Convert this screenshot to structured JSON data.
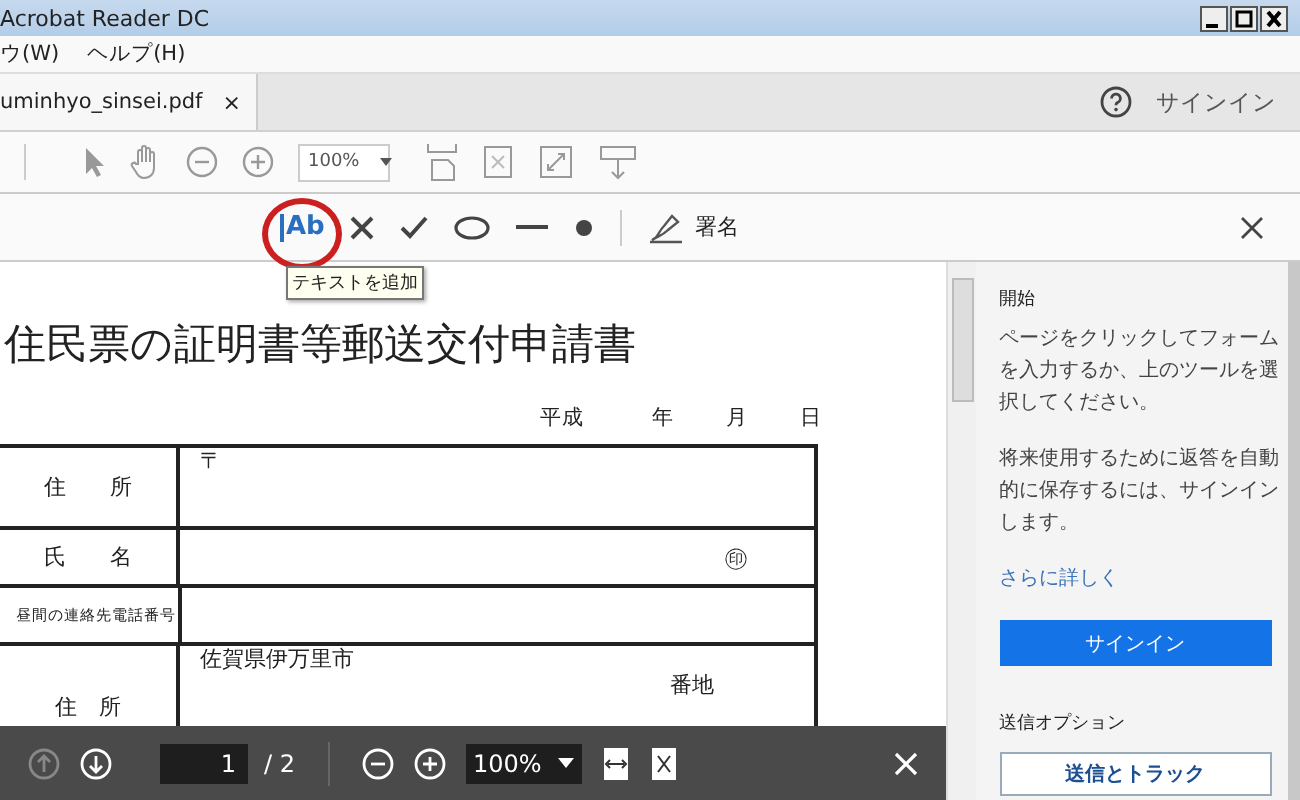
{
  "window": {
    "title": "Acrobat Reader DC"
  },
  "menu": [
    {
      "label": "ウ(W)"
    },
    {
      "label": "ヘルプ(H)"
    }
  ],
  "tab": {
    "label": "uminhyo_sinsei.pdf",
    "close": "×"
  },
  "account": {
    "signin": "サインイン"
  },
  "toolbar": {
    "zoom": "100%"
  },
  "fill_sign": {
    "tools": [
      {
        "kind": "text",
        "label": "Ab",
        "selected": true
      },
      {
        "kind": "cross",
        "selected": false
      },
      {
        "kind": "check",
        "selected": false
      },
      {
        "kind": "ellipse",
        "selected": false
      },
      {
        "kind": "line",
        "selected": false
      },
      {
        "kind": "dot",
        "selected": false
      }
    ],
    "sign": "署名",
    "tooltip": "テキストを追加"
  },
  "document": {
    "title": "住民票の証明書等郵送交付申請書",
    "date": [
      "平成",
      "年",
      "月",
      "日"
    ],
    "rows": [
      {
        "label": "住　　所",
        "value": "〒"
      },
      {
        "label": "氏　　名",
        "seal": "㊞"
      },
      {
        "label": "昼間の連絡先電話番号"
      },
      {
        "label": "住　所",
        "value": "佐賀県伊万里市",
        "suffix": "番地"
      }
    ]
  },
  "panel": {
    "heading": "開始",
    "paragraphs": [
      "ページをクリックしてフォームを入力するか、上のツールを選択してください。",
      "将来使用するために返答を自動的に保存するには、サインインします。"
    ],
    "link": "さらに詳しく",
    "button": "サインイン",
    "section": "送信オプション",
    "buttons": [
      "送信とトラック"
    ]
  },
  "page_nav": {
    "current": "1",
    "total": "/ 2",
    "zoom": "100%"
  }
}
